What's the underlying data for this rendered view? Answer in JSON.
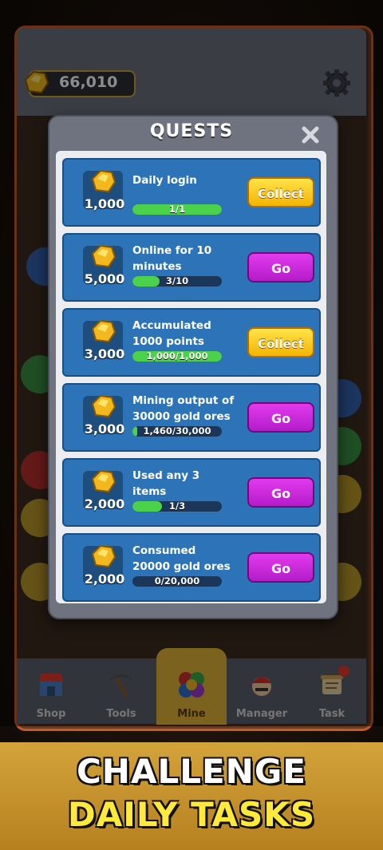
{
  "hud": {
    "gold_amount": "66,010"
  },
  "icons": {
    "gold": "gold-ore-icon",
    "settings": "gear-icon",
    "close": "close-icon"
  },
  "modal": {
    "title": "QUESTS",
    "quests": [
      {
        "reward": "1,000",
        "title": "Daily login",
        "progress_text": "1/1",
        "progress": 1.0,
        "button": "Collect",
        "button_type": "collect"
      },
      {
        "reward": "5,000",
        "title": "Online for 10 minutes",
        "progress_text": "3/10",
        "progress": 0.3,
        "button": "Go",
        "button_type": "go"
      },
      {
        "reward": "3,000",
        "title": "Accumulated 1000 points",
        "progress_text": "1,000/1,000",
        "progress": 1.0,
        "button": "Collect",
        "button_type": "collect"
      },
      {
        "reward": "3,000",
        "title": "Mining output of 30000 gold ores",
        "progress_text": "1,460/30,000",
        "progress": 0.05,
        "button": "Go",
        "button_type": "go"
      },
      {
        "reward": "2,000",
        "title": "Used any 3 items",
        "progress_text": "1/3",
        "progress": 0.33,
        "button": "Go",
        "button_type": "go"
      },
      {
        "reward": "2,000",
        "title": "Consumed 20000 gold ores",
        "progress_text": "0/20,000",
        "progress": 0.0,
        "button": "Go",
        "button_type": "go"
      }
    ]
  },
  "nav": [
    {
      "label": "Shop",
      "icon": "shop-icon"
    },
    {
      "label": "Tools",
      "icon": "pickaxe-icon"
    },
    {
      "label": "Mine",
      "icon": "mine-icon"
    },
    {
      "label": "Manager",
      "icon": "manager-icon"
    },
    {
      "label": "Task",
      "icon": "task-scroll-icon"
    }
  ],
  "banner": {
    "line1": "CHALLENGE",
    "line2": "DAILY TASKS"
  },
  "colors": {
    "collect": "#f4c20d",
    "go": "#c020d8",
    "progress": "#4bd14b",
    "quest_bg": "#2d73b8"
  }
}
